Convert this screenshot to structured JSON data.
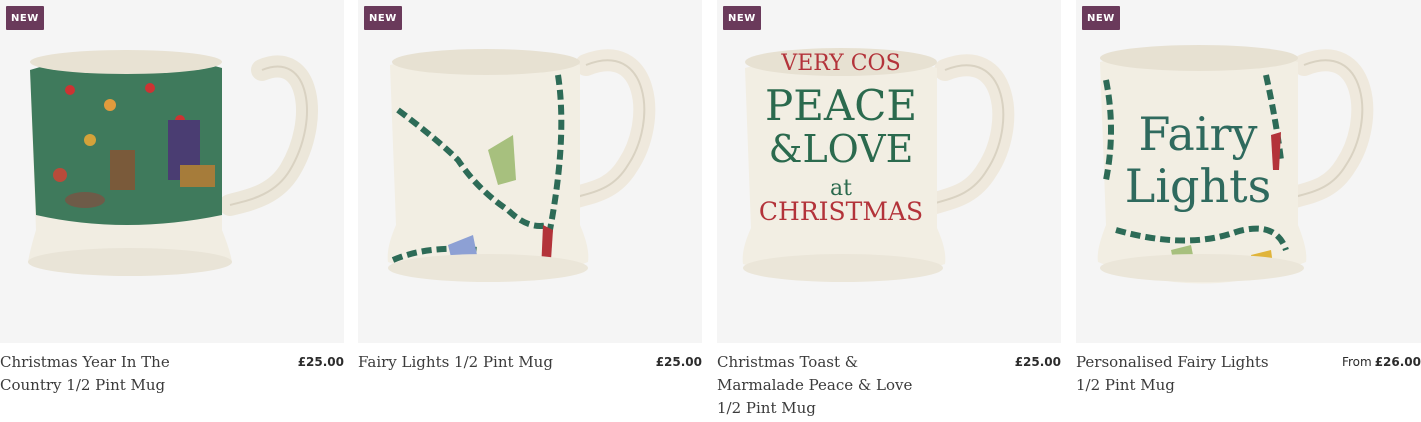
{
  "products": [
    {
      "badge": "NEW",
      "title": "Christmas Year In The Country 1/2 Pint Mug",
      "price_prefix": "",
      "price": "£25.00"
    },
    {
      "badge": "NEW",
      "title": "Fairy Lights 1/2 Pint Mug",
      "price_prefix": "",
      "price": "£25.00"
    },
    {
      "badge": "NEW",
      "title": "Christmas Toast & Marmalade Peace & Love 1/2 Pint Mug",
      "price_prefix": "",
      "price": "£25.00"
    },
    {
      "badge": "NEW",
      "title": "Personalised Fairy Lights 1/2 Pint Mug",
      "price_prefix": "From",
      "price": "£26.00"
    }
  ],
  "mug_art": {
    "mug2": [
      "Fairy",
      "Lights"
    ],
    "mug3": [
      "PEACE",
      "&LOVE",
      "at",
      "CHRISTMAS",
      "VERY COS"
    ]
  },
  "colors": {
    "badge": "#6a3a5b",
    "cream": "#f3efe4",
    "green": "#2b6a55",
    "red": "#b3333a"
  }
}
